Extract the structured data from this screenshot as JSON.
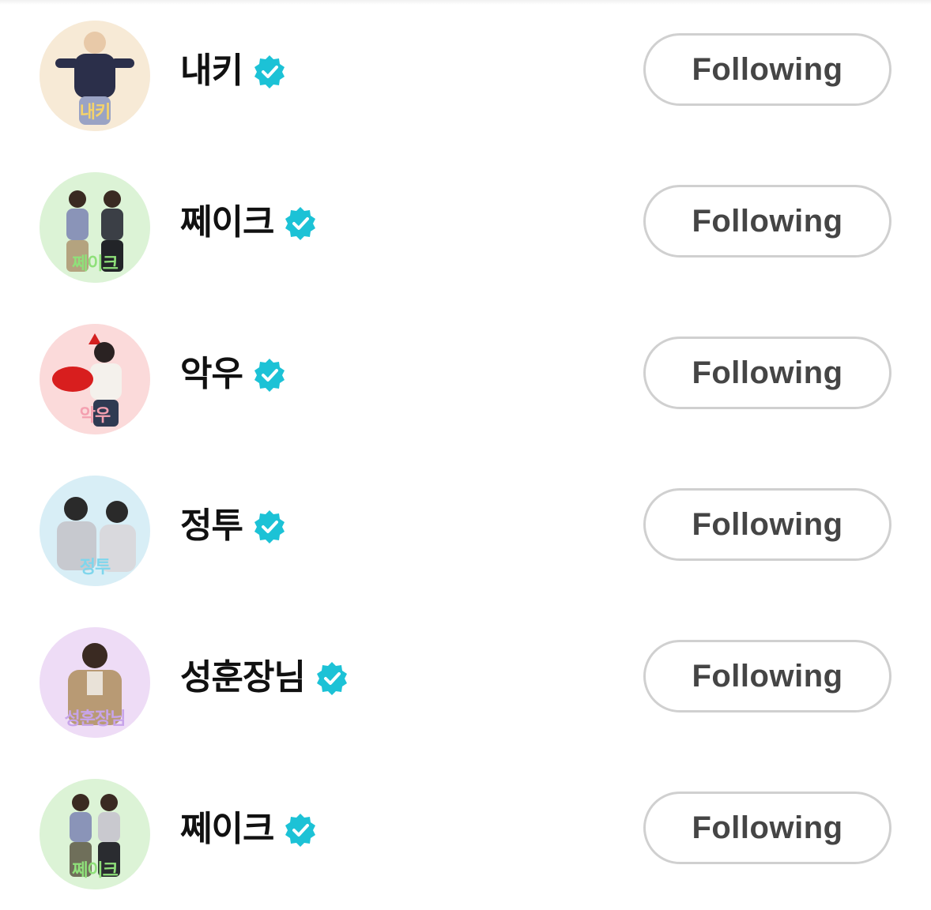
{
  "accent": "#1cc2d6",
  "following_list": [
    {
      "name": "내키",
      "avatar_caption": "내키",
      "verified": true,
      "button_label": "Following",
      "avatar_tint": "#f7ead6",
      "caption_color": "#f5d36a"
    },
    {
      "name": "쩨이크",
      "avatar_caption": "쩨이크",
      "verified": true,
      "button_label": "Following",
      "avatar_tint": "#dcf3d6",
      "caption_color": "#8fe07a"
    },
    {
      "name": "악우",
      "avatar_caption": "악우",
      "verified": true,
      "button_label": "Following",
      "avatar_tint": "#fbdada",
      "caption_color": "#f4a0b0"
    },
    {
      "name": "정투",
      "avatar_caption": "정투",
      "verified": true,
      "button_label": "Following",
      "avatar_tint": "#d8eef6",
      "caption_color": "#7fd6ec"
    },
    {
      "name": "성훈장님",
      "avatar_caption": "성훈장님",
      "verified": true,
      "button_label": "Following",
      "avatar_tint": "#eedcf6",
      "caption_color": "#c7a4ea"
    },
    {
      "name": "쩨이크",
      "avatar_caption": "쩨이크",
      "verified": true,
      "button_label": "Following",
      "avatar_tint": "#dcf3d6",
      "caption_color": "#8fe07a"
    }
  ]
}
